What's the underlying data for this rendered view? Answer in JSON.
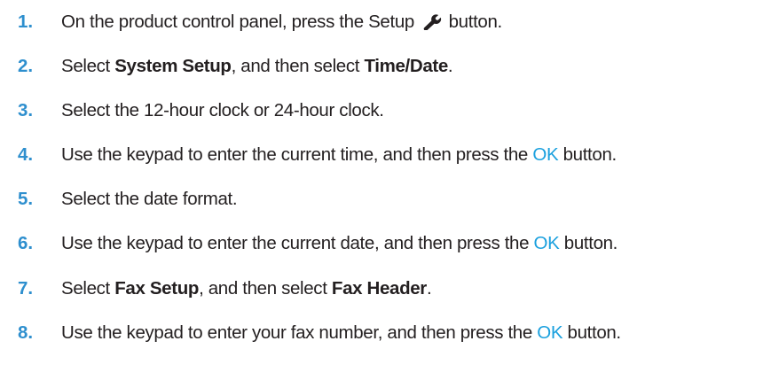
{
  "steps": [
    {
      "number": "1.",
      "parts": [
        {
          "text": "On the product control panel, press the Setup "
        },
        {
          "icon": "wrench-icon"
        },
        {
          "text": " button."
        }
      ]
    },
    {
      "number": "2.",
      "parts": [
        {
          "text": "Select "
        },
        {
          "text": "System Setup",
          "bold": true
        },
        {
          "text": ", and then select "
        },
        {
          "text": "Time/Date",
          "bold": true
        },
        {
          "text": "."
        }
      ]
    },
    {
      "number": "3.",
      "parts": [
        {
          "text": "Select the 12-hour clock or 24-hour clock."
        }
      ]
    },
    {
      "number": "4.",
      "parts": [
        {
          "text": "Use the keypad to enter the current time, and then press the "
        },
        {
          "text": "OK",
          "accent": true
        },
        {
          "text": " button."
        }
      ]
    },
    {
      "number": "5.",
      "parts": [
        {
          "text": "Select the date format."
        }
      ]
    },
    {
      "number": "6.",
      "parts": [
        {
          "text": "Use the keypad to enter the current date, and then press the "
        },
        {
          "text": "OK",
          "accent": true
        },
        {
          "text": " button."
        }
      ]
    },
    {
      "number": "7.",
      "parts": [
        {
          "text": "Select "
        },
        {
          "text": "Fax Setup",
          "bold": true
        },
        {
          "text": ", and then select "
        },
        {
          "text": "Fax Header",
          "bold": true
        },
        {
          "text": "."
        }
      ]
    },
    {
      "number": "8.",
      "parts": [
        {
          "text": "Use the keypad to enter your fax number, and then press the "
        },
        {
          "text": "OK",
          "accent": true
        },
        {
          "text": " button."
        }
      ]
    }
  ],
  "colors": {
    "step_number": "#2e8fce",
    "ok_accent": "#1aa0de",
    "body_text": "#231f20"
  }
}
